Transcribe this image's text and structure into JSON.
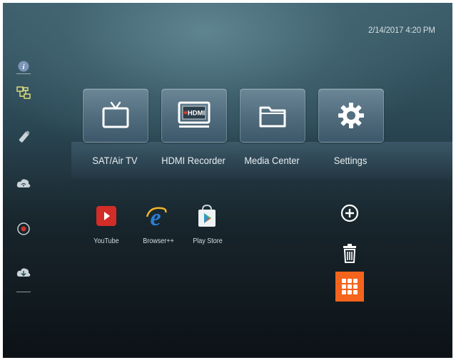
{
  "status_bar": {
    "datetime": "2/14/2017 4:20 PM"
  },
  "sidebar": {
    "items": [
      {
        "icon": "info-icon"
      },
      {
        "icon": "network-icon"
      },
      {
        "icon": "usb-icon"
      },
      {
        "icon": "wifi-cloud-icon"
      },
      {
        "icon": "record-icon"
      },
      {
        "icon": "cloud-download-icon"
      }
    ]
  },
  "main_menu": {
    "tiles": [
      {
        "label": "SAT/Air TV",
        "icon": "tv-icon"
      },
      {
        "label": "HDMI Recorder",
        "icon": "hdmi-recorder-icon",
        "badge": "HDMI"
      },
      {
        "label": "Media Center",
        "icon": "folder-icon"
      },
      {
        "label": "Settings",
        "icon": "gear-icon"
      }
    ]
  },
  "apps": [
    {
      "label": "YouTube",
      "icon": "youtube-icon"
    },
    {
      "label": "Browser++",
      "icon": "browser-icon"
    },
    {
      "label": "Play Store",
      "icon": "play-store-icon"
    }
  ],
  "actions": {
    "add": {
      "icon": "plus-circle-icon"
    },
    "delete": {
      "icon": "trash-icon"
    },
    "all_apps": {
      "icon": "grid-icon"
    }
  },
  "colors": {
    "highlight": "#f5641c",
    "youtube_red": "#d32d27",
    "browser_blue": "#2a7fd6"
  }
}
